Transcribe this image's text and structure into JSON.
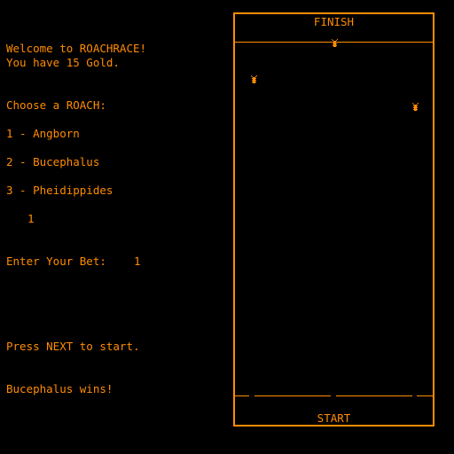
{
  "intro": {
    "welcome": "Welcome to ROACHRACE!",
    "gold": "You have 15 Gold."
  },
  "choose_prompt": "Choose a ROACH:",
  "roaches": [
    {
      "label": "1 - Angborn"
    },
    {
      "label": "2 - Bucephalus"
    },
    {
      "label": "3 - Pheidippides"
    }
  ],
  "choice_input": "1",
  "bet": {
    "label": "Enter Your Bet:",
    "value": "1"
  },
  "next_prompt": "Press NEXT to start.",
  "result": "Bucephalus wins!",
  "track": {
    "finish_label": "FINISH",
    "start_label": "START",
    "icon": "roach-icon"
  },
  "colors": {
    "fg": "#ff8c00",
    "bg": "#000000"
  }
}
